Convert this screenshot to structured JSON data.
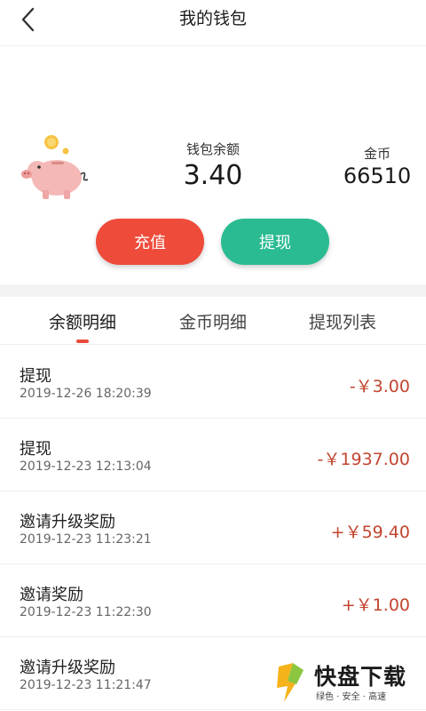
{
  "header": {
    "title": "我的钱包",
    "back_icon": "chevron-left-icon"
  },
  "wallet": {
    "balance_label": "钱包余额",
    "balance_value": "3.40",
    "coin_label": "金币",
    "coin_value": "66510",
    "pig_icon": "piggy-bank-icon"
  },
  "actions": {
    "recharge": "充值",
    "withdraw": "提现"
  },
  "colors": {
    "recharge": "#ee4b3b",
    "withdraw": "#2bbb93",
    "accent": "#e84a3a",
    "amount": "#c2452f"
  },
  "tabs": [
    {
      "label": "余额明细",
      "active": true
    },
    {
      "label": "金币明细",
      "active": false
    },
    {
      "label": "提现列表",
      "active": false
    }
  ],
  "transactions": [
    {
      "title": "提现",
      "date": "2019-12-26 18:20:39",
      "amount": "-￥3.00"
    },
    {
      "title": "提现",
      "date": "2019-12-23 12:13:04",
      "amount": "-￥1937.00"
    },
    {
      "title": "邀请升级奖励",
      "date": "2019-12-23 11:23:21",
      "amount": "+￥59.40"
    },
    {
      "title": "邀请奖励",
      "date": "2019-12-23 11:22:30",
      "amount": "+￥1.00"
    },
    {
      "title": "邀请升级奖励",
      "date": "2019-12-23 11:21:47",
      "amount": ""
    }
  ],
  "watermark": {
    "name": "快盘下载",
    "tagline": "绿色 · 安全 · 高速"
  }
}
